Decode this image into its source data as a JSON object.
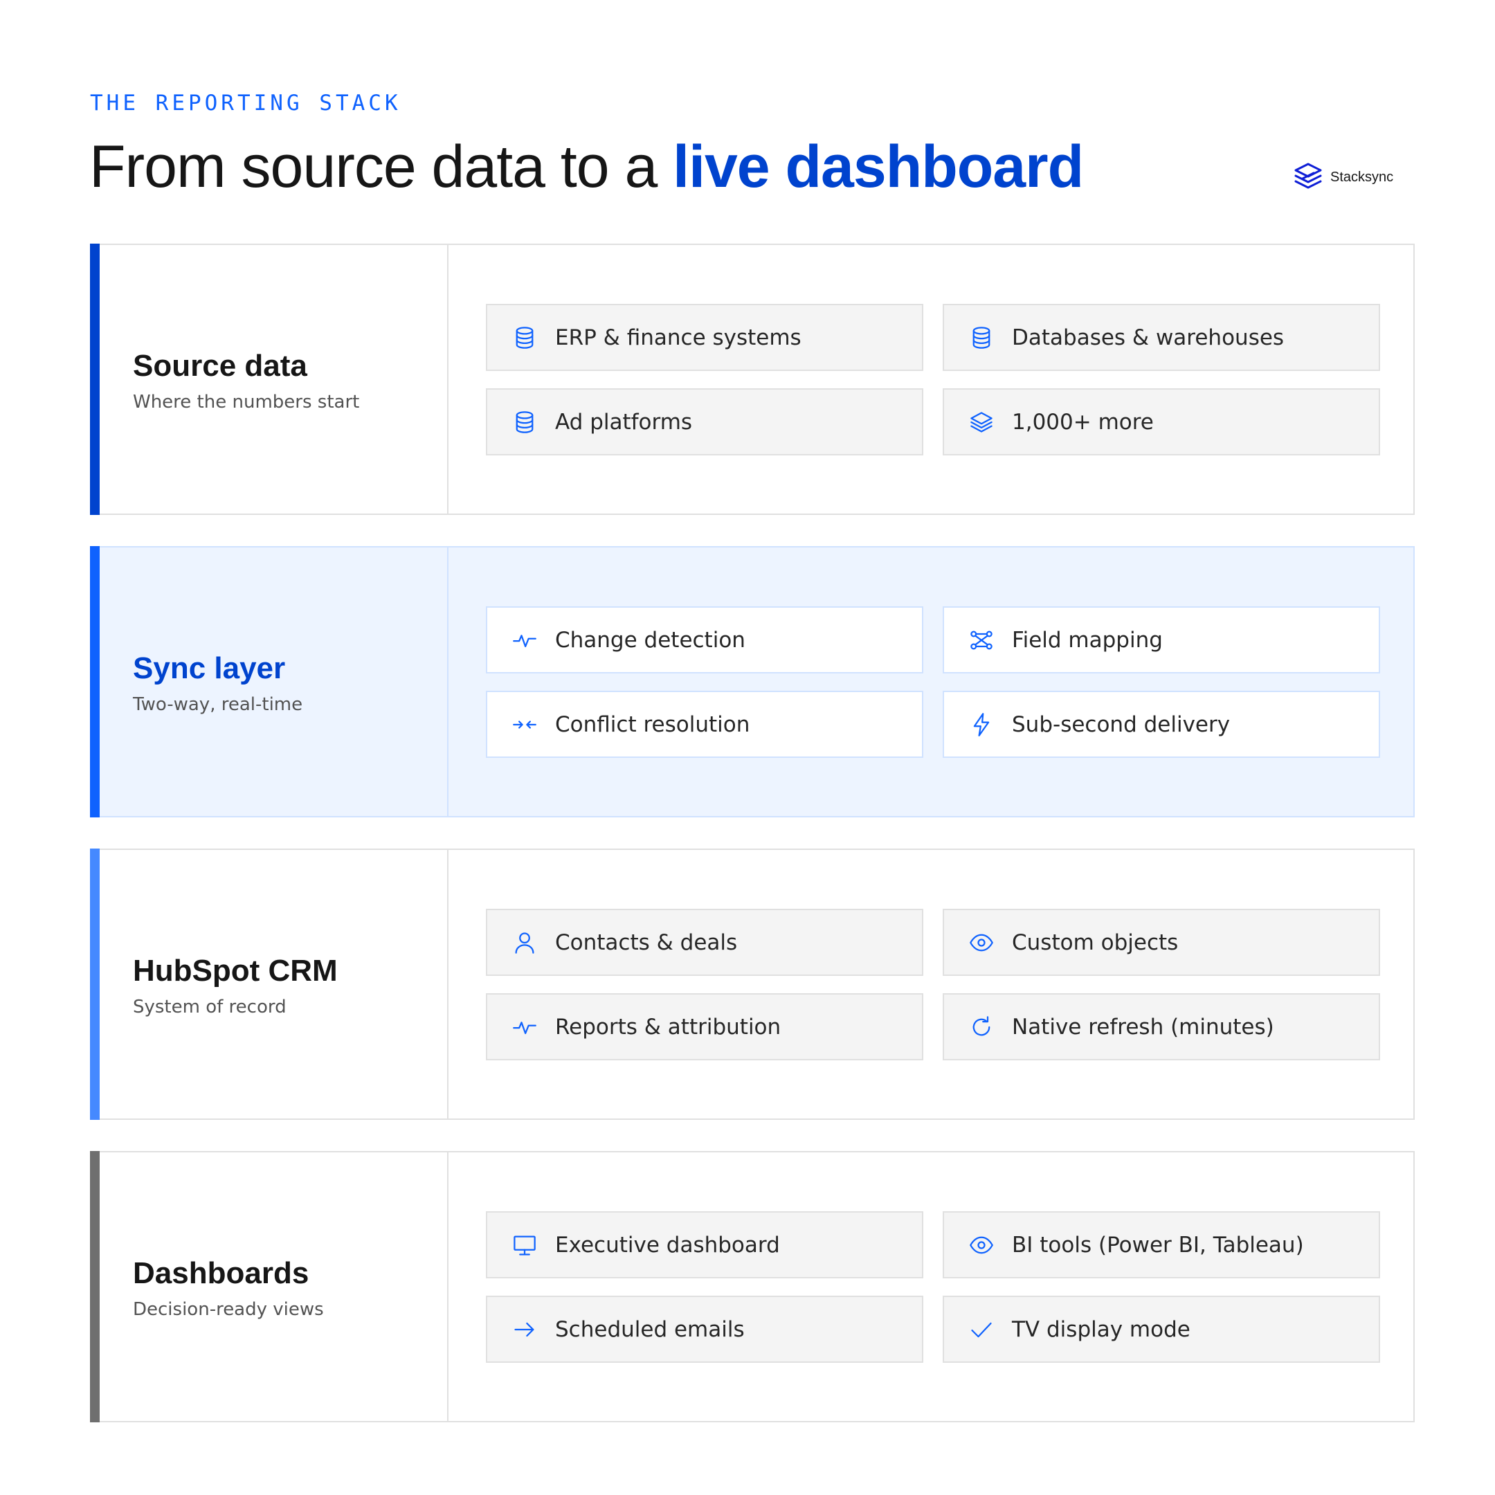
{
  "header": {
    "eyebrow": "THE REPORTING STACK",
    "headline_prefix": "From source data to a ",
    "headline_accent": "live dashboard"
  },
  "brand": {
    "name": "Stacksync",
    "color": "#0f1fd6"
  },
  "colors": {
    "accent": "#0f62fe",
    "accent_dark": "#0043ce",
    "bar_gray": "#6f6f6f"
  },
  "layers": [
    {
      "title": "Source data",
      "subtitle": "Where the numbers start",
      "bar_color": "#0043ce",
      "items": [
        {
          "label": "ERP & finance systems",
          "icon": "database-icon"
        },
        {
          "label": "Databases & warehouses",
          "icon": "database-icon"
        },
        {
          "label": "Ad platforms",
          "icon": "database-icon"
        },
        {
          "label": "1,000+ more",
          "icon": "layers-icon"
        }
      ]
    },
    {
      "title": "Sync layer",
      "subtitle": "Two-way, real-time",
      "bar_color": "#0f62fe",
      "items": [
        {
          "label": "Change detection",
          "icon": "activity-icon"
        },
        {
          "label": "Field mapping",
          "icon": "mapping-icon"
        },
        {
          "label": "Conflict resolution",
          "icon": "merge-icon"
        },
        {
          "label": "Sub-second delivery",
          "icon": "lightning-icon"
        }
      ]
    },
    {
      "title": "HubSpot CRM",
      "subtitle": "System of record",
      "bar_color": "#4589ff",
      "items": [
        {
          "label": "Contacts & deals",
          "icon": "user-icon"
        },
        {
          "label": "Custom objects",
          "icon": "eye-icon"
        },
        {
          "label": "Reports & attribution",
          "icon": "activity-icon"
        },
        {
          "label": "Native refresh (minutes)",
          "icon": "refresh-icon"
        }
      ]
    },
    {
      "title": "Dashboards",
      "subtitle": "Decision-ready views",
      "bar_color": "#6f6f6f",
      "items": [
        {
          "label": "Executive dashboard",
          "icon": "monitor-icon"
        },
        {
          "label": "BI tools (Power BI, Tableau)",
          "icon": "eye-icon"
        },
        {
          "label": "Scheduled emails",
          "icon": "arrow-right-icon"
        },
        {
          "label": "TV display mode",
          "icon": "checkmark-icon"
        }
      ]
    }
  ]
}
